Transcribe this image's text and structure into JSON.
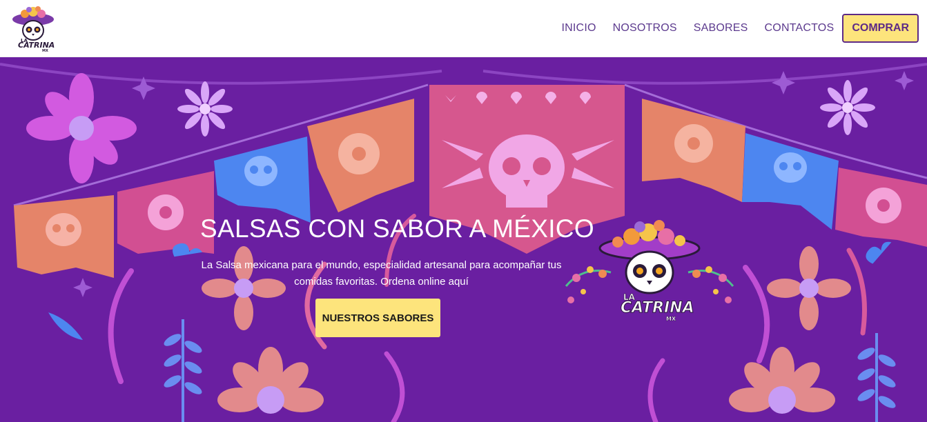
{
  "brand": {
    "logo_text_main": "CATRINA",
    "logo_text_top": "LA",
    "logo_text_sub": "MX"
  },
  "nav": {
    "items": [
      {
        "label": "INICIO"
      },
      {
        "label": "NOSOTROS"
      },
      {
        "label": "SABORES"
      },
      {
        "label": "CONTACTOS"
      }
    ],
    "buy_label": "COMPRAR"
  },
  "hero": {
    "title": "SALSAS CON SABOR A MÉXICO",
    "subtitle": "La Salsa mexicana para el mundo, especialidad artesanal para acompañar tus comidas favoritas. Ordena online aquí",
    "cta_label": "NUESTROS SABORES"
  },
  "colors": {
    "hero_bg": "#6a1fa1",
    "accent_yellow": "#fde47c",
    "nav_text": "#5c3a8e",
    "papel_pink": "#d15a8f",
    "papel_orange": "#e0806d",
    "papel_blue": "#4f86f0"
  }
}
